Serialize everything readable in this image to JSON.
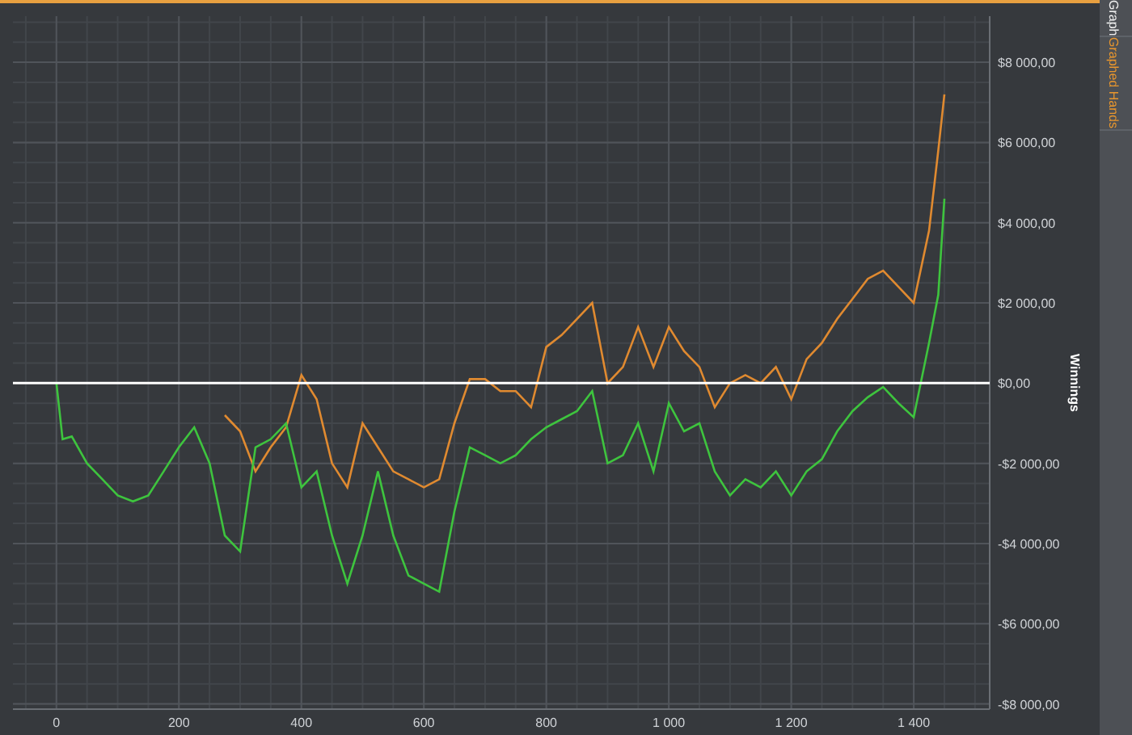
{
  "chart_data": {
    "type": "line",
    "ylabel": "Winnings",
    "xlim": [
      -71,
      1524
    ],
    "ylim": [
      -8130,
      9150
    ],
    "x": [
      0,
      10,
      25,
      50,
      75,
      100,
      125,
      150,
      175,
      200,
      225,
      250,
      275,
      300,
      325,
      350,
      375,
      400,
      425,
      450,
      475,
      500,
      525,
      550,
      575,
      600,
      625,
      650,
      675,
      700,
      725,
      750,
      775,
      800,
      825,
      850,
      875,
      900,
      925,
      950,
      975,
      1000,
      1025,
      1050,
      1075,
      1100,
      1125,
      1150,
      1175,
      1200,
      1225,
      1250,
      1275,
      1300,
      1325,
      1350,
      1375,
      1400,
      1425,
      1440,
      1450
    ],
    "series": [
      {
        "color": "#e08a30",
        "values": [
          null,
          null,
          null,
          null,
          null,
          null,
          null,
          null,
          null,
          null,
          null,
          null,
          -800,
          -1200,
          -2200,
          -1600,
          -1100,
          200,
          -400,
          -2000,
          -2600,
          -1000,
          -1600,
          -2200,
          -2400,
          -2600,
          -2400,
          -1000,
          100,
          100,
          -200,
          -200,
          -600,
          900,
          1200,
          1600,
          2000,
          0,
          400,
          1400,
          400,
          1400,
          800,
          400,
          -600,
          0,
          200,
          0,
          400,
          -400,
          600,
          1000,
          1600,
          2100,
          2600,
          2800,
          2400,
          2000,
          3800,
          5800,
          7200
        ]
      },
      {
        "color": "#3ec43e",
        "values": [
          0,
          -1400,
          -1330,
          -2000,
          -2400,
          -2800,
          -2950,
          -2800,
          -2200,
          -1600,
          -1100,
          -2000,
          -3800,
          -4200,
          -1600,
          -1400,
          -1000,
          -2600,
          -2200,
          -3800,
          -5000,
          -3800,
          -2200,
          -3800,
          -4800,
          -5000,
          -5200,
          -3200,
          -1600,
          -1800,
          -2000,
          -1800,
          -1400,
          -1100,
          -900,
          -700,
          -200,
          -2000,
          -1800,
          -1000,
          -2200,
          -500,
          -1200,
          -1000,
          -2200,
          -2800,
          -2400,
          -2600,
          -2200,
          -2800,
          -2200,
          -1900,
          -1200,
          -700,
          -350,
          -100,
          -500,
          -850,
          1000,
          2200,
          4600
        ]
      }
    ],
    "xticks": [
      0,
      200,
      400,
      600,
      800,
      {
        "value": 1000,
        "label": "1 000"
      },
      {
        "value": 1200,
        "label": "1 200"
      },
      {
        "value": 1400,
        "label": "1 400"
      }
    ],
    "yticks": [
      {
        "value": 8000,
        "label": "$8 000,00"
      },
      {
        "value": 6000,
        "label": "$6 000,00"
      },
      {
        "value": 4000,
        "label": "$4 000,00"
      },
      {
        "value": 2000,
        "label": "$2 000,00"
      },
      {
        "value": 0,
        "label": "$0,00"
      },
      {
        "value": -2000,
        "label": "-$2 000,00"
      },
      {
        "value": -4000,
        "label": "-$4 000,00"
      },
      {
        "value": -6000,
        "label": "-$6 000,00"
      },
      {
        "value": -8000,
        "label": "-$8 000,00"
      }
    ],
    "grid": true,
    "ref_lines": [
      {
        "axis": "y",
        "value": 0,
        "color": "#ffffff"
      }
    ]
  },
  "tabs": [
    {
      "label": "Graph",
      "selected": false
    },
    {
      "label": "Graphed Hands",
      "selected": true
    }
  ]
}
